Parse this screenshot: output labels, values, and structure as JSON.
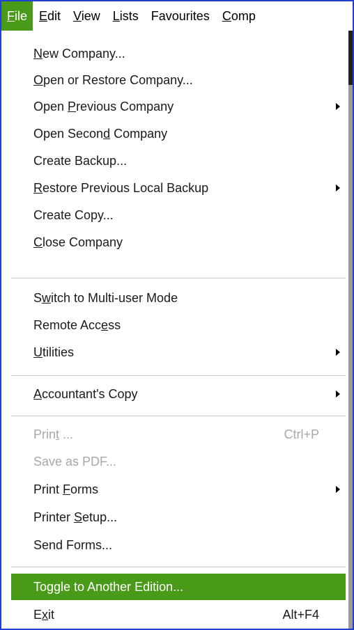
{
  "menubar": {
    "items": [
      {
        "pre": "",
        "u": "F",
        "post": "ile"
      },
      {
        "pre": "",
        "u": "E",
        "post": "dit"
      },
      {
        "pre": "",
        "u": "V",
        "post": "iew"
      },
      {
        "pre": "",
        "u": "L",
        "post": "ists"
      },
      {
        "pre": "Favourites",
        "u": "",
        "post": ""
      },
      {
        "pre": "",
        "u": "C",
        "post": "omp"
      }
    ]
  },
  "menu": {
    "new_company": {
      "pre": "",
      "u": "N",
      "post": "ew Company..."
    },
    "open_restore": {
      "pre": "",
      "u": "O",
      "post": "pen or Restore Company..."
    },
    "open_previous": {
      "pre": "Open ",
      "u": "P",
      "post": "revious Company"
    },
    "open_second": {
      "pre": "Open Secon",
      "u": "d",
      "post": " Company"
    },
    "create_backup": {
      "pre": "Create Backup...",
      "u": "",
      "post": ""
    },
    "restore_previous": {
      "pre": "",
      "u": "R",
      "post": "estore Previous Local Backup"
    },
    "create_copy": {
      "pre": "Create Copy...",
      "u": "",
      "post": ""
    },
    "close_company": {
      "pre": "",
      "u": "C",
      "post": "lose Company"
    },
    "switch_multiuser": {
      "pre": "S",
      "u": "w",
      "post": "itch to Multi-user Mode"
    },
    "remote_access": {
      "pre": "Remote Acc",
      "u": "e",
      "post": "ss"
    },
    "utilities": {
      "pre": "",
      "u": "U",
      "post": "tilities"
    },
    "accountants_copy": {
      "pre": "",
      "u": "A",
      "post": "ccountant's Copy"
    },
    "print": {
      "pre": "Prin",
      "u": "t",
      "post": " ...",
      "shortcut": "Ctrl+P"
    },
    "save_pdf": {
      "pre": "Save as PDF...",
      "u": "",
      "post": ""
    },
    "print_forms": {
      "pre": "Print ",
      "u": "F",
      "post": "orms"
    },
    "printer_setup": {
      "pre": "Printer ",
      "u": "S",
      "post": "etup..."
    },
    "send_forms": {
      "pre": "Send Forms...",
      "u": "",
      "post": ""
    },
    "toggle_edition": {
      "pre": "Toggle to Another Edition...",
      "u": "",
      "post": ""
    },
    "exit": {
      "pre": "E",
      "u": "x",
      "post": "it",
      "shortcut": "Alt+F4"
    }
  },
  "colors": {
    "highlight": "#4a9a1a",
    "frame_border": "#1f3fd6",
    "disabled_text": "#a8a8a8"
  }
}
